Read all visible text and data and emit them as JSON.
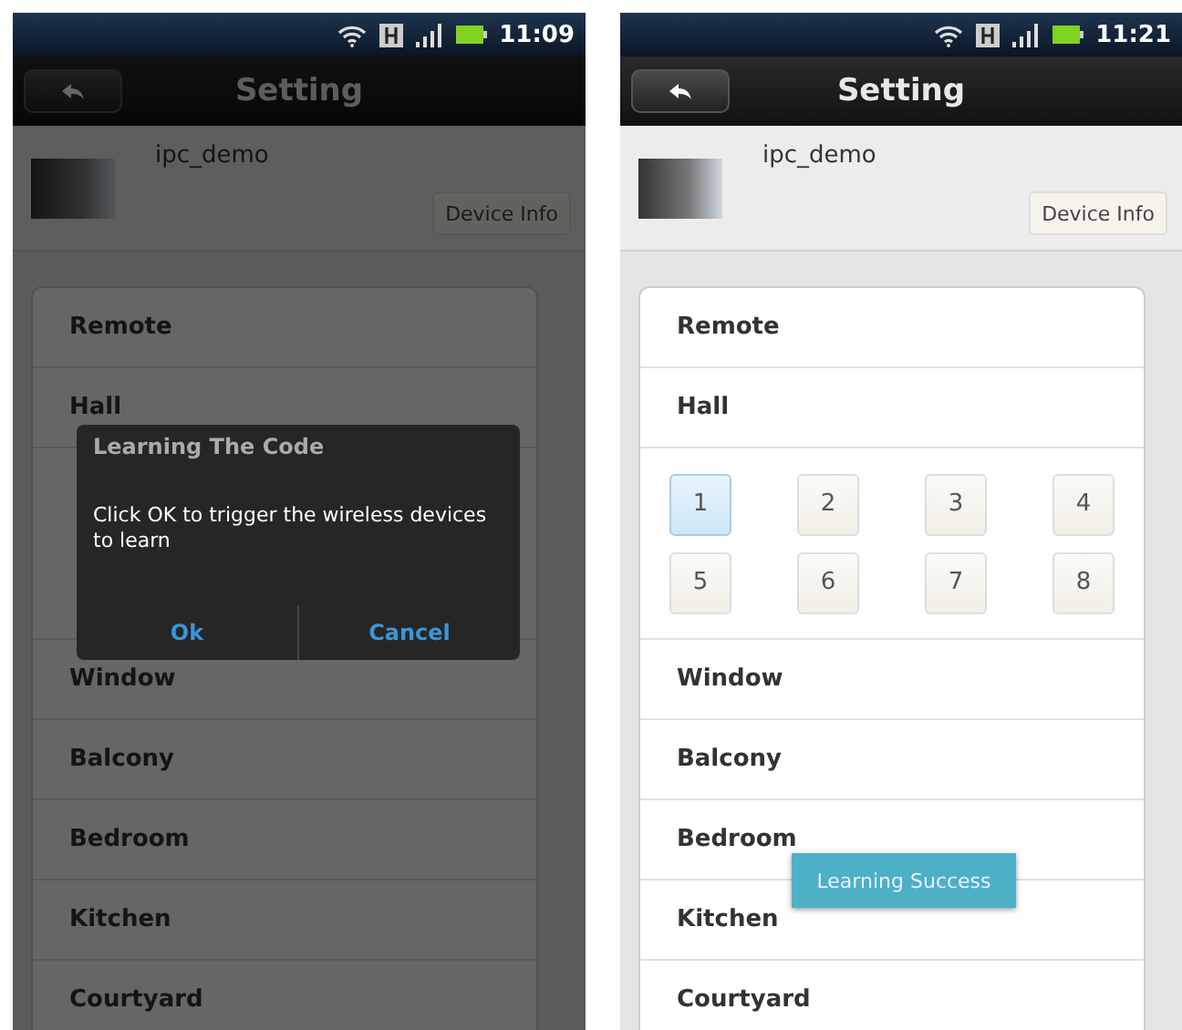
{
  "screens": [
    {
      "status_bar": {
        "time": "11:09"
      },
      "title": "Setting",
      "device": {
        "name": "ipc_demo",
        "button": "Device Info"
      },
      "rooms": [
        {
          "kind": "room",
          "label": "Remote"
        },
        {
          "kind": "room",
          "label": "Hall"
        },
        {
          "kind": "covered_keypad"
        },
        {
          "kind": "room",
          "label": "Window"
        },
        {
          "kind": "room",
          "label": "Balcony"
        },
        {
          "kind": "room",
          "label": "Bedroom"
        },
        {
          "kind": "room",
          "label": "Kitchen"
        },
        {
          "kind": "room",
          "label": "Courtyard"
        }
      ],
      "dialog": {
        "title": "Learning The Code",
        "message": "Click OK to trigger the wireless devices to learn",
        "buttons": [
          "Ok",
          "Cancel"
        ]
      }
    },
    {
      "status_bar": {
        "time": "11:21"
      },
      "title": "Setting",
      "device": {
        "name": "ipc_demo",
        "button": "Device Info"
      },
      "rooms": [
        {
          "kind": "room",
          "label": "Remote"
        },
        {
          "kind": "room",
          "label": "Hall"
        },
        {
          "kind": "keypad",
          "keys": [
            {
              "label": "1",
              "selected": true
            },
            {
              "label": "2",
              "selected": false
            },
            {
              "label": "3",
              "selected": false
            },
            {
              "label": "4",
              "selected": false
            },
            {
              "label": "5",
              "selected": false
            },
            {
              "label": "6",
              "selected": false
            },
            {
              "label": "7",
              "selected": false
            },
            {
              "label": "8",
              "selected": false
            }
          ]
        },
        {
          "kind": "room",
          "label": "Window"
        },
        {
          "kind": "room",
          "label": "Balcony"
        },
        {
          "kind": "room",
          "label": "Bedroom"
        },
        {
          "kind": "room",
          "label": "Kitchen"
        },
        {
          "kind": "room",
          "label": "Courtyard"
        }
      ],
      "toast": "Learning Success"
    }
  ]
}
